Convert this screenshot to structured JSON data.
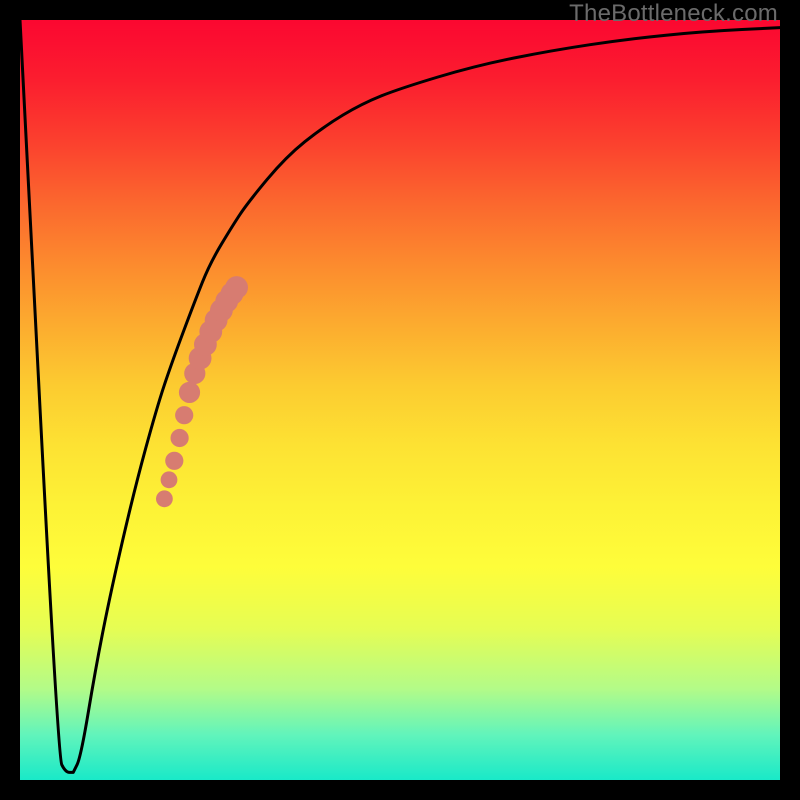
{
  "watermark": "TheBottleneck.com",
  "colors": {
    "curve_stroke": "#000000",
    "marker_fill": "#d77c71",
    "frame_bg": "#000000"
  },
  "chart_data": {
    "type": "line",
    "title": "",
    "xlabel": "",
    "ylabel": "",
    "xlim": [
      0,
      100
    ],
    "ylim": [
      0,
      100
    ],
    "legend": false,
    "grid": false,
    "series": [
      {
        "name": "left-falling-edge",
        "x": [
          0,
          5,
          6,
          7
        ],
        "y": [
          100,
          3,
          1,
          1
        ]
      },
      {
        "name": "main-curve",
        "x": [
          7,
          8,
          10,
          12,
          15,
          18,
          20,
          23,
          25,
          28,
          30,
          35,
          40,
          45,
          50,
          60,
          70,
          80,
          90,
          100
        ],
        "y": [
          1,
          3,
          15,
          25,
          38,
          49,
          55,
          63,
          68,
          73,
          76,
          82,
          86,
          89,
          91,
          94,
          96,
          97.5,
          98.5,
          99
        ]
      },
      {
        "name": "marker-band",
        "x": [
          19,
          19.5,
          20,
          20.5,
          21,
          21.3,
          21.6,
          22,
          22.8,
          23.5,
          24,
          24.5,
          25,
          25.5,
          26,
          26.5,
          27,
          27.5,
          28,
          28.5
        ],
        "y": [
          37,
          39,
          41,
          43,
          45,
          46.5,
          48,
          49.5,
          53,
          55,
          56.5,
          57.5,
          58.5,
          59.5,
          60.5,
          61.5,
          62.5,
          63.2,
          64,
          64.7
        ]
      }
    ],
    "markers": [
      {
        "x": 19.0,
        "y": 37.0,
        "r": 1.1
      },
      {
        "x": 19.6,
        "y": 39.5,
        "r": 1.1
      },
      {
        "x": 20.3,
        "y": 42.0,
        "r": 1.2
      },
      {
        "x": 21.0,
        "y": 45.0,
        "r": 1.2
      },
      {
        "x": 21.6,
        "y": 48.0,
        "r": 1.2
      },
      {
        "x": 22.3,
        "y": 51.0,
        "r": 1.4
      },
      {
        "x": 23.0,
        "y": 53.5,
        "r": 1.4
      },
      {
        "x": 23.7,
        "y": 55.5,
        "r": 1.5
      },
      {
        "x": 24.4,
        "y": 57.3,
        "r": 1.5
      },
      {
        "x": 25.1,
        "y": 59.0,
        "r": 1.5
      },
      {
        "x": 25.8,
        "y": 60.5,
        "r": 1.5
      },
      {
        "x": 26.5,
        "y": 61.8,
        "r": 1.5
      },
      {
        "x": 27.2,
        "y": 63.0,
        "r": 1.5
      },
      {
        "x": 27.9,
        "y": 64.0,
        "r": 1.5
      },
      {
        "x": 28.5,
        "y": 64.8,
        "r": 1.5
      }
    ]
  }
}
